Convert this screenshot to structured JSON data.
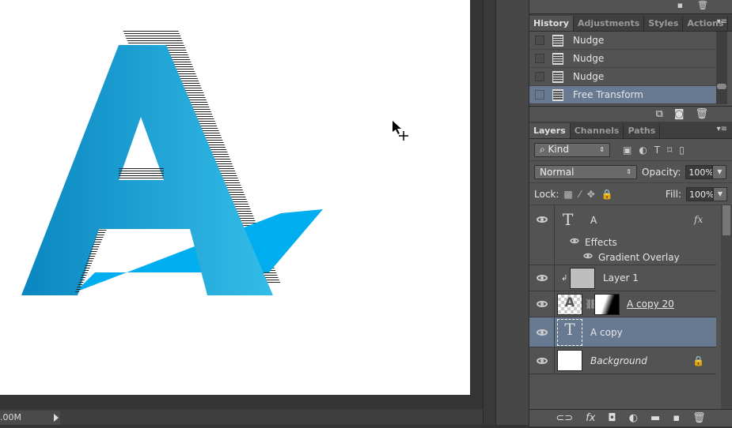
{
  "status": {
    "doc_size": ".00M"
  },
  "history": {
    "tabs": [
      "History",
      "Adjustments",
      "Styles",
      "Actions"
    ],
    "items": [
      {
        "label": "Nudge"
      },
      {
        "label": "Nudge"
      },
      {
        "label": "Nudge"
      },
      {
        "label": "Free Transform",
        "selected": true
      }
    ]
  },
  "layers": {
    "tabs": [
      "Layers",
      "Channels",
      "Paths"
    ],
    "filter": "Kind",
    "blend": "Normal",
    "opacity_label": "Opacity:",
    "opacity": "100%",
    "lock_label": "Lock:",
    "fill_label": "Fill:",
    "fill": "100%",
    "items": [
      {
        "name": "A",
        "fx": "fx",
        "effects": "Effects",
        "effect": "Gradient Overlay"
      },
      {
        "name": "Layer 1"
      },
      {
        "name": "A copy 20"
      },
      {
        "name": "A copy",
        "selected": true
      },
      {
        "name": "Background"
      }
    ]
  },
  "colors": {
    "accent_blue": "#1aa3dc",
    "selection": "#687a92"
  }
}
